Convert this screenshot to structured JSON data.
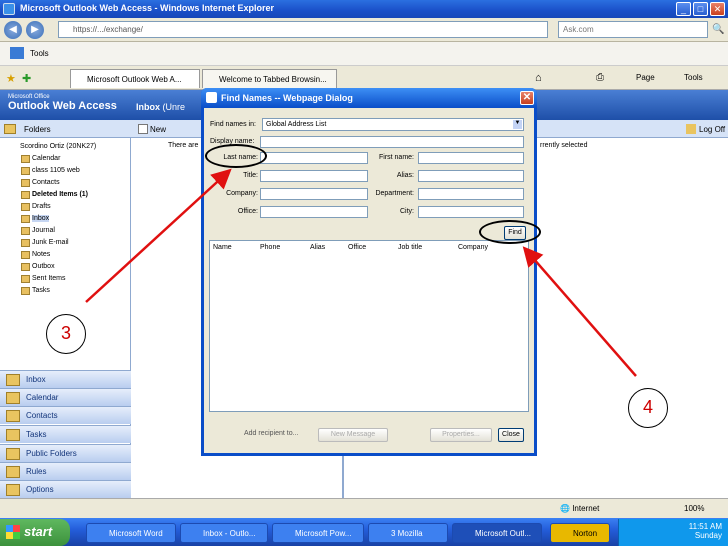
{
  "browser": {
    "title": "Microsoft Outlook Web Access - Windows Internet Explorer",
    "address": "https://.../exchange/",
    "search_placeholder": "Ask.com",
    "links_label": "Tools",
    "toolbar_right": [
      "Page",
      "Tools"
    ],
    "tabs": [
      "Microsoft Outlook Web A...",
      "Welcome to Tabbed Browsin..."
    ]
  },
  "owa": {
    "brand": "Microsoft Office",
    "title": "Outlook Web Access",
    "inbox_header": "Inbox",
    "inbox_suffix": "(Unre",
    "new_button": "New",
    "logoff": "Log Off",
    "folders_label": "Folders",
    "view_text": "There are",
    "reading_pane_text": "rrently selected",
    "mailbox": "Scordino Ortiz (20NK27)",
    "folders": [
      "Calendar",
      "class 1105 web",
      "Contacts",
      "Deleted Items (1)",
      "Drafts",
      "Inbox",
      "Journal",
      "Junk E-mail",
      "Notes",
      "Outbox",
      "Sent Items",
      "Tasks"
    ],
    "nav": [
      "Inbox",
      "Calendar",
      "Contacts",
      "Tasks",
      "Public Folders",
      "Rules",
      "Options"
    ]
  },
  "dialog": {
    "title": "Find Names -- Webpage Dialog",
    "find_in_label": "Find names in:",
    "find_in_value": "Global Address List",
    "display_name": "Display name:",
    "last_name": "Last name:",
    "first_name": "First name:",
    "title_label": "Title:",
    "alias": "Alias:",
    "company": "Company:",
    "department": "Department:",
    "office": "Office:",
    "city": "City:",
    "find_button": "Find",
    "columns": [
      "Name",
      "Phone",
      "Alias",
      "Office",
      "Job title",
      "Company"
    ],
    "add_recipient": "Add recipient to...",
    "new_message": "New Message",
    "properties": "Properties...",
    "close": "Close"
  },
  "status": {
    "zone": "Internet",
    "zoom": "100%"
  },
  "taskbar": {
    "start": "start",
    "items": [
      "Microsoft Word",
      "Inbox - Outlo...",
      "Microsoft Pow...",
      "3 Mozilla",
      "Microsoft Outl..."
    ],
    "norton": "Norton",
    "time": "11:51 AM",
    "day": "Sunday"
  },
  "callouts": {
    "step3": "3",
    "step4": "4"
  },
  "colors": {
    "arrow": "#e01010",
    "xp_blue": "#245edb"
  }
}
